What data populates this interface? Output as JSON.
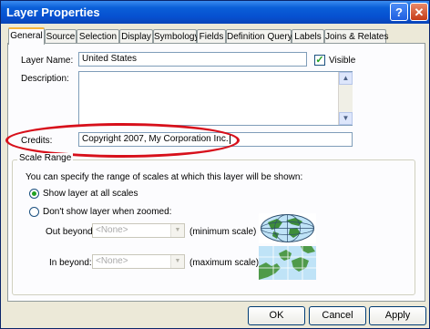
{
  "window": {
    "title": "Layer Properties"
  },
  "titlebar": {
    "help_glyph": "?",
    "close_glyph": "✕"
  },
  "tabs": [
    {
      "label": "General"
    },
    {
      "label": "Source"
    },
    {
      "label": "Selection"
    },
    {
      "label": "Display"
    },
    {
      "label": "Symbology"
    },
    {
      "label": "Fields"
    },
    {
      "label": "Definition Query"
    },
    {
      "label": "Labels"
    },
    {
      "label": "Joins & Relates"
    }
  ],
  "general": {
    "layer_name_label": "Layer Name:",
    "layer_name_value": "United States",
    "visible_label": "Visible",
    "visible_checked": true,
    "description_label": "Description:",
    "description_value": "",
    "credits_label": "Credits:",
    "credits_value": "Copyright 2007, My Corporation Inc."
  },
  "scale_range": {
    "group_label": "Scale Range",
    "intro_text": "You can specify the range of scales at which this layer will be shown:",
    "option_all": "Show layer at all scales",
    "option_zoomed": "Don't show layer when zoomed:",
    "selected": "all",
    "out_beyond_label": "Out beyond:",
    "out_beyond_value": "<None>",
    "out_beyond_hint": "(minimum scale)",
    "in_beyond_label": "In beyond:",
    "in_beyond_value": "<None>",
    "in_beyond_hint": "(maximum scale)"
  },
  "buttons": {
    "ok": "OK",
    "cancel": "Cancel",
    "apply": "Apply"
  },
  "icons": {
    "min_scale": "globe-icon",
    "max_scale": "map-zoomed-icon"
  },
  "colors": {
    "titlebar": "#0a5fd8",
    "highlight_ellipse": "#d7101b",
    "active_tab_accent": "#f7b43b"
  }
}
